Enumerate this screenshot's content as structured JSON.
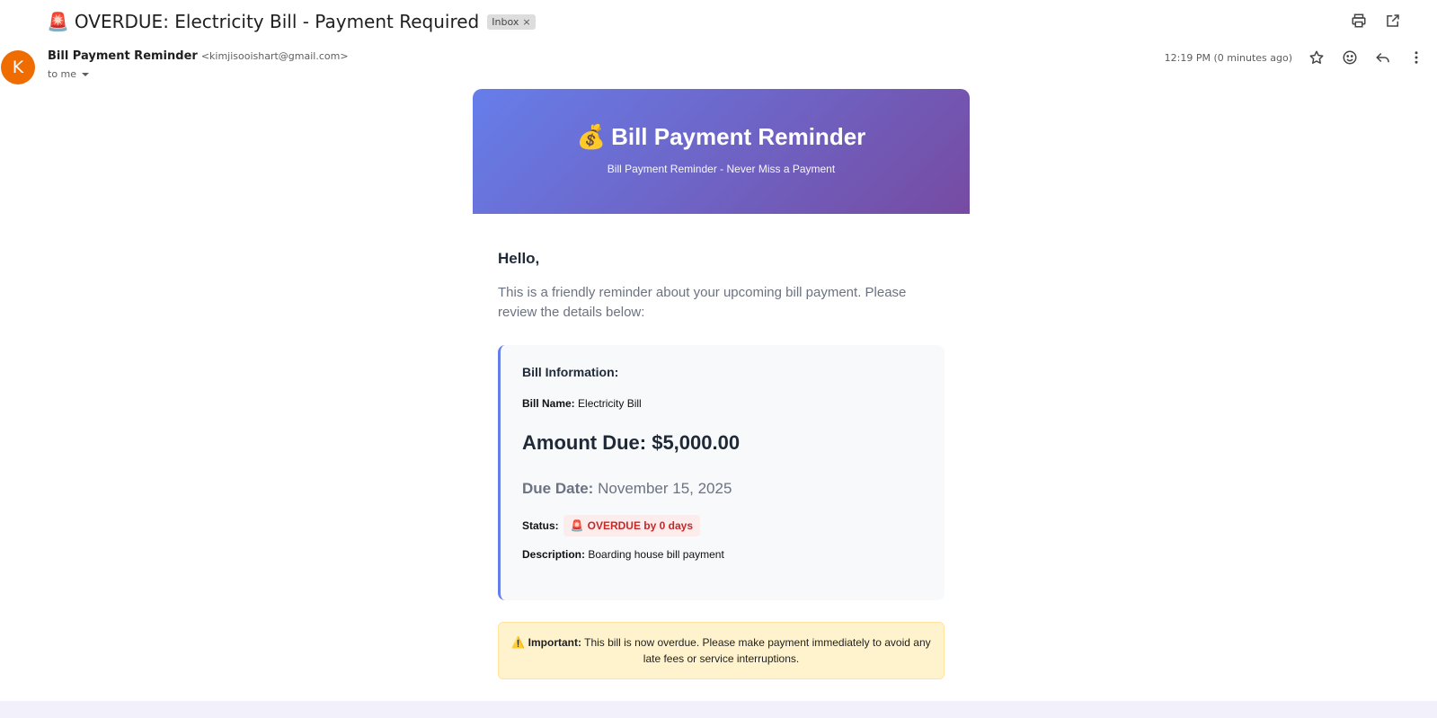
{
  "header": {
    "subject_emoji": "🚨",
    "subject": "OVERDUE: Electricity Bill - Payment Required",
    "label_chip": "Inbox",
    "label_chip_close": "×",
    "icons": [
      "print-icon",
      "open-in-new-window-icon"
    ]
  },
  "sender": {
    "avatar_letter": "K",
    "avatar_color": "#ef6c00",
    "name": "Bill Payment Reminder",
    "email": "<kimjisooishart@gmail.com>",
    "to": "to me",
    "timestamp": "12:19 PM (0 minutes ago)",
    "actions": [
      "star-icon",
      "emoji-reaction-icon",
      "reply-icon",
      "more-options-icon"
    ]
  },
  "email": {
    "hero_emoji": "💰",
    "hero_title": "Bill Payment Reminder",
    "hero_subtitle": "Bill Payment Reminder - Never Miss a Payment",
    "gradient_start": "#667eea",
    "gradient_end": "#764ba2",
    "greeting": "Hello,",
    "intro": "This is a friendly reminder about your upcoming bill payment. Please review the details below:",
    "info": {
      "heading": "Bill Information:",
      "bill_name_label": "Bill Name:",
      "bill_name": "Electricity Bill",
      "amount": "Amount Due: $5,000.00",
      "due_label": "Due Date:",
      "due_date": "November 15, 2025",
      "status_label": "Status:",
      "status_emoji": "🚨",
      "status_text": "OVERDUE by 0 days",
      "status_color": "#c62828",
      "desc_label": "Description:",
      "description": "Boarding house bill payment"
    },
    "warning": {
      "emoji": "⚠️",
      "label": "Important:",
      "text": "This bill is now overdue. Please make payment immediately to avoid any late fees or service interruptions."
    }
  }
}
